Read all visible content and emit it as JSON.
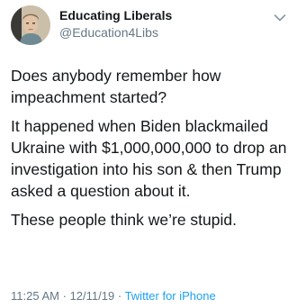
{
  "author": {
    "display_name": "Educating Liberals",
    "handle": "@Education4Libs",
    "avatar_icon": "profile-photo"
  },
  "menu": {
    "icon": "chevron-down-icon"
  },
  "tweet": {
    "paragraphs": [
      "Does anybody remember how impeachment started?",
      "It happened when Biden blackmailed Ukraine with $1,000,000,000 to drop an investigation into his son & then Trump asked a question about it.",
      "These people think we’re stupid."
    ]
  },
  "meta": {
    "time": "11:25 AM",
    "separator1": "·",
    "date": "12/11/19",
    "separator2": "·",
    "source": "Twitter for iPhone"
  },
  "colors": {
    "text": "#14171a",
    "muted": "#657786",
    "link": "#1da1f2"
  }
}
